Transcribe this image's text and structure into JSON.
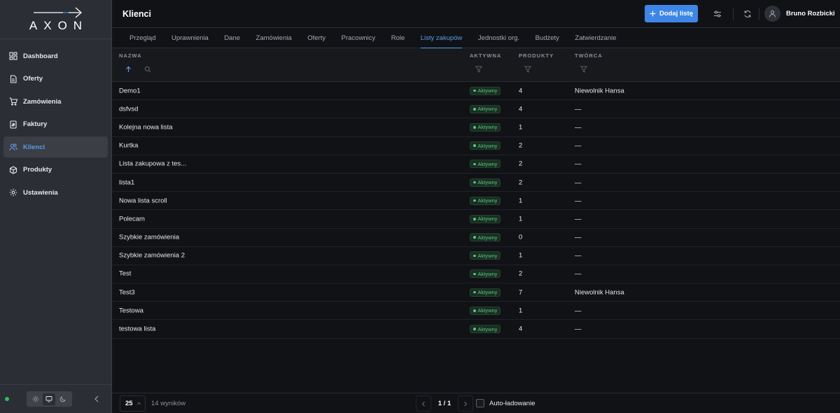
{
  "brand": {
    "logo_text": "AXON"
  },
  "sidebar": {
    "items": [
      {
        "label": "Dashboard",
        "icon": "dashboard-icon"
      },
      {
        "label": "Oferty",
        "icon": "document-icon"
      },
      {
        "label": "Zamówienia",
        "icon": "cart-icon"
      },
      {
        "label": "Faktury",
        "icon": "invoice-icon"
      },
      {
        "label": "Klienci",
        "icon": "users-icon",
        "active": true
      },
      {
        "label": "Produkty",
        "icon": "box-icon"
      },
      {
        "label": "Ustawienia",
        "icon": "gear-icon"
      }
    ],
    "status": "online",
    "theme_options": [
      "light",
      "system",
      "dark"
    ],
    "selected_theme": "system"
  },
  "header": {
    "title": "Klienci",
    "add_button_label": "Dodaj listę",
    "user_name": "Bruno Rozbicki"
  },
  "tabs": [
    {
      "label": "Przegląd"
    },
    {
      "label": "Uprawnienia"
    },
    {
      "label": "Dane"
    },
    {
      "label": "Zamówienia"
    },
    {
      "label": "Oferty"
    },
    {
      "label": "Pracownicy"
    },
    {
      "label": "Role"
    },
    {
      "label": "Listy zakupów",
      "active": true
    },
    {
      "label": "Jednostki org."
    },
    {
      "label": "Budżety"
    },
    {
      "label": "Zatwierdzanie"
    }
  ],
  "table": {
    "columns": {
      "name": "NAZWA",
      "active": "AKTYWNA",
      "products": "PRODUKTY",
      "creator": "TWÓRCA"
    },
    "rows": [
      {
        "name": "Demo1",
        "active": "Aktywny",
        "products": "4",
        "creator": "Niewolnik Hansa"
      },
      {
        "name": "dsfvsd",
        "active": "Aktywny",
        "products": "4",
        "creator": "—"
      },
      {
        "name": "Kolejna nowa lista",
        "active": "Aktywny",
        "products": "1",
        "creator": "—"
      },
      {
        "name": "Kurtka",
        "active": "Aktywny",
        "products": "2",
        "creator": "—"
      },
      {
        "name": "Lista zakupowa z tes...",
        "active": "Aktywny",
        "products": "2",
        "creator": "—"
      },
      {
        "name": "lista1",
        "active": "Aktywny",
        "products": "2",
        "creator": "—"
      },
      {
        "name": "Nowa lista scroll",
        "active": "Aktywny",
        "products": "1",
        "creator": "—"
      },
      {
        "name": "Polecam",
        "active": "Aktywny",
        "products": "1",
        "creator": "—"
      },
      {
        "name": "Szybkie zamówienia",
        "active": "Aktywny",
        "products": "0",
        "creator": "—"
      },
      {
        "name": "Szybkie zamówienia 2",
        "active": "Aktywny",
        "products": "1",
        "creator": "—"
      },
      {
        "name": "Test",
        "active": "Aktywny",
        "products": "2",
        "creator": "—"
      },
      {
        "name": "Test3",
        "active": "Aktywny",
        "products": "7",
        "creator": "Niewolnik Hansa"
      },
      {
        "name": "Testowa",
        "active": "Aktywny",
        "products": "1",
        "creator": "—"
      },
      {
        "name": "testowa lista",
        "active": "Aktywny",
        "products": "4",
        "creator": "—"
      }
    ]
  },
  "footer": {
    "page_size": "25",
    "results": "14 wyników",
    "page": "1 / 1",
    "autoload_label": "Auto-ładowanie"
  },
  "colors": {
    "accent": "#3d86e8",
    "active_badge": "#54c57f",
    "status_online": "#2fbe5a"
  }
}
